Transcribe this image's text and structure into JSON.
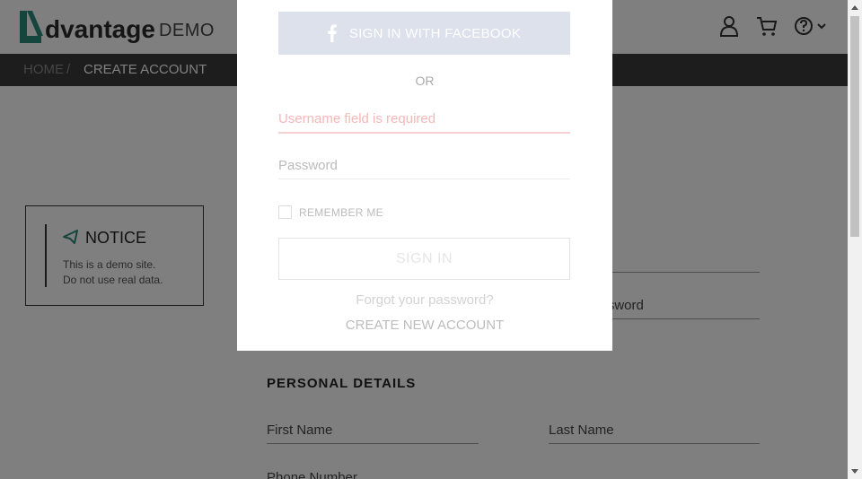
{
  "header": {
    "logo_text": "dvantage",
    "logo_demo": "DEMO",
    "icons": [
      "user-icon",
      "cart-icon",
      "help-icon",
      "chevron-down-icon"
    ]
  },
  "breadcrumb": {
    "home": "HOME",
    "separator": "/",
    "current": "CREATE ACCOUNT"
  },
  "notice": {
    "title": "NOTICE",
    "line1": "This is a demo site.",
    "line2": "Do not use real data."
  },
  "form": {
    "password_partial": "assword",
    "section_personal": "PERSONAL DETAILS",
    "first_name": "First Name",
    "last_name": "Last Name",
    "phone_number": "Phone Number"
  },
  "modal": {
    "facebook_button": "SIGN IN WITH FACEBOOK",
    "or_text": "OR",
    "username_error": "Username field is required",
    "password_placeholder": "Password",
    "remember_me": "REMEMBER ME",
    "sign_in_button": "SIGN IN",
    "forgot_password": "Forgot your password?",
    "create_account": "CREATE NEW ACCOUNT"
  },
  "colors": {
    "accent": "#2a8a7a",
    "breadcrumb_bg": "#3a3a3a",
    "facebook_btn": "#dce1ec",
    "error_text": "#f6b7b7"
  }
}
